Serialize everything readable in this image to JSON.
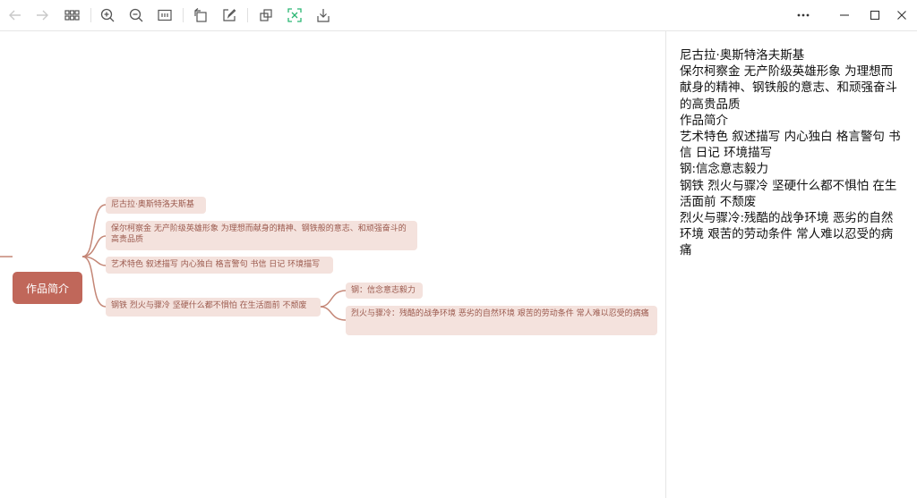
{
  "toolbar": {
    "buttons": [
      {
        "name": "back-icon",
        "icon": "arrow-left"
      },
      {
        "name": "forward-icon",
        "icon": "arrow-right"
      },
      {
        "name": "grid-view-icon",
        "icon": "grid"
      },
      {
        "name": "zoom-in-icon",
        "icon": "zoom-in"
      },
      {
        "name": "zoom-out-icon",
        "icon": "zoom-out"
      },
      {
        "name": "fit-width-icon",
        "icon": "fit"
      },
      {
        "name": "rotate-icon",
        "icon": "rotate"
      },
      {
        "name": "edit-icon",
        "icon": "edit"
      },
      {
        "name": "copy-icon",
        "icon": "copy"
      },
      {
        "name": "ocr-icon",
        "icon": "scan"
      },
      {
        "name": "save-icon",
        "icon": "download"
      },
      {
        "name": "more-icon",
        "icon": "more"
      },
      {
        "name": "minimize-icon",
        "icon": "minimize"
      },
      {
        "name": "maximize-icon",
        "icon": "maximize"
      },
      {
        "name": "close-icon",
        "icon": "close"
      }
    ],
    "accent_color": "#2bb673"
  },
  "mindmap": {
    "root": "作品简介",
    "root_color": "#c0675a",
    "node_color": "#f4e2dd",
    "nodes": {
      "n1": "尼古拉·奥斯特洛夫斯基",
      "n2": "保尔柯察金 无产阶级英雄形象 为理想而献身的精神、钢铁般的意志、和顽强奋斗的高贵品质",
      "n3": "艺术特色 叙述描写 内心独白 格言警句 书信 日记 环境描写",
      "n4": "钢铁 烈火与骤冷 坚硬什么都不惧怕 在生活面前 不颓废",
      "n4a": "钢：信念意志毅力",
      "n4b": "烈火与骤冷：残酷的战争环境  恶劣的自然环境 艰苦的劳动条件 常人难以忍受的病痛"
    }
  },
  "outline": {
    "lines": [
      "尼古拉·奥斯特洛夫斯基",
      "保尔柯察金 无产阶级英雄形象 为理想而献身的精神、钢铁般的意志、和顽强奋斗的高贵品质",
      "作品简介",
      "艺术特色 叙述描写 内心独白 格言警句 书信 日记 环境描写",
      "钢:信念意志毅力",
      "钢铁 烈火与骤冷 坚硬什么都不惧怕 在生活面前 不颓废",
      "烈火与骤冷:残酷的战争环境 恶劣的自然环境 艰苦的劳动条件 常人难以忍受的病痛"
    ]
  }
}
